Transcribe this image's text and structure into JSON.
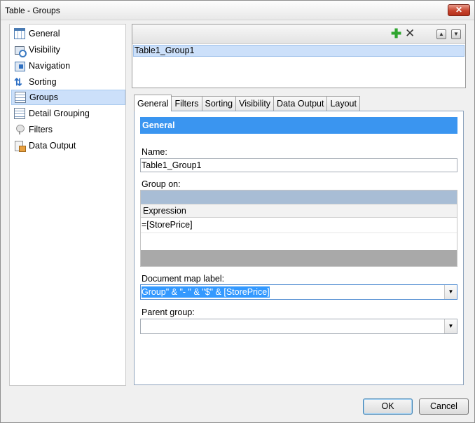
{
  "window": {
    "title": "Table - Groups",
    "close_glyph": "✕"
  },
  "nav": {
    "items": [
      {
        "label": "General",
        "icon": "table-grid-icon"
      },
      {
        "label": "Visibility",
        "icon": "visibility-icon"
      },
      {
        "label": "Navigation",
        "icon": "navigation-icon"
      },
      {
        "label": "Sorting",
        "icon": "sorting-icon"
      },
      {
        "label": "Groups",
        "icon": "groups-icon",
        "selected": true
      },
      {
        "label": "Detail Grouping",
        "icon": "detail-grouping-icon"
      },
      {
        "label": "Filters",
        "icon": "filter-icon"
      },
      {
        "label": "Data Output",
        "icon": "data-output-icon"
      }
    ]
  },
  "groups": {
    "add_glyph": "✚",
    "delete_glyph": "✕",
    "up_glyph": "▲",
    "down_glyph": "▼",
    "items": [
      "Table1_Group1"
    ]
  },
  "tabs": [
    {
      "label": "General",
      "active": true
    },
    {
      "label": "Filters"
    },
    {
      "label": "Sorting"
    },
    {
      "label": "Visibility"
    },
    {
      "label": "Data Output"
    },
    {
      "label": "Layout"
    }
  ],
  "general": {
    "header": "General",
    "name_label": "Name:",
    "name_value": "Table1_Group1",
    "group_on_label": "Group on:",
    "expression_header": "Expression",
    "expressions": [
      "=[StorePrice]"
    ],
    "doc_map_label": "Document map label:",
    "doc_map_value": "Group\" & \"- \" & \"$\" & [StorePrice]",
    "parent_group_label": "Parent group:",
    "parent_group_value": "",
    "dropdown_glyph": "▼"
  },
  "footer": {
    "ok_label": "OK",
    "cancel_label": "Cancel"
  },
  "colors": {
    "accent": "#3a95f0",
    "selection": "#cce0fa"
  }
}
